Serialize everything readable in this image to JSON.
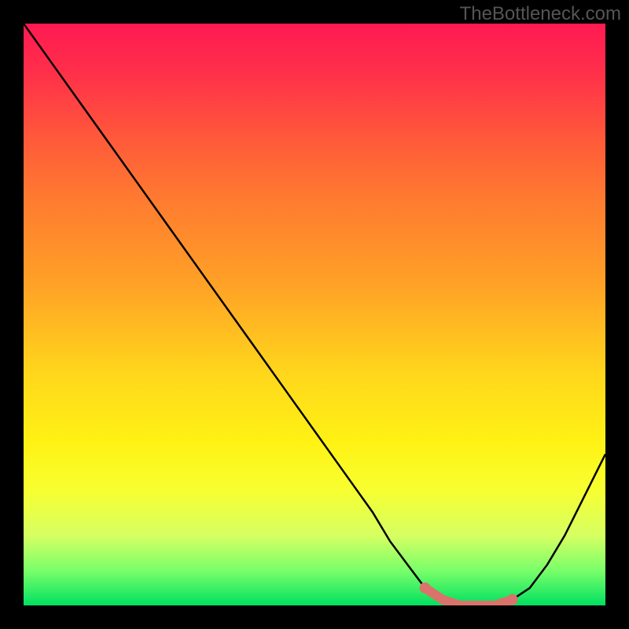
{
  "watermark": "TheBottleneck.com",
  "chart_data": {
    "type": "line",
    "title": "",
    "xlabel": "",
    "ylabel": "",
    "xlim": [
      0,
      100
    ],
    "ylim": [
      0,
      100
    ],
    "background_gradient": {
      "top": "#ff1a52",
      "middle": "#ffd61c",
      "bottom": "#00e060",
      "description": "vertical red-to-green gradient indicating high-to-low bottleneck"
    },
    "series": [
      {
        "name": "bottleneck-curve",
        "color": "#000000",
        "x": [
          0,
          5,
          10,
          15,
          20,
          25,
          30,
          35,
          40,
          45,
          50,
          55,
          60,
          63,
          66,
          69,
          72,
          75,
          78,
          81,
          84,
          87,
          90,
          93,
          96,
          100
        ],
        "values": [
          100,
          93,
          86,
          79,
          72,
          65,
          58,
          51,
          44,
          37,
          30,
          23,
          16,
          11,
          7,
          3,
          1,
          0,
          0,
          0,
          1,
          3,
          7,
          12,
          18,
          26
        ]
      }
    ],
    "highlight": {
      "name": "optimal-range",
      "color": "#d9736b",
      "x_start": 69,
      "x_end": 84,
      "description": "salmon marker segment at curve minimum with endpoint dots"
    }
  }
}
